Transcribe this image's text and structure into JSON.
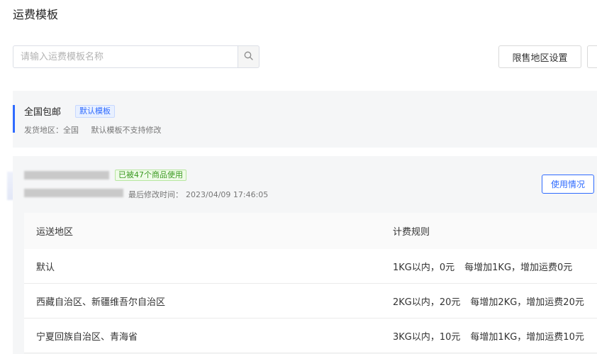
{
  "page": {
    "title": "运费模板"
  },
  "search": {
    "placeholder": "请输入运费模板名称",
    "icon": "search-icon"
  },
  "toolbar": {
    "restrict_label": "限售地区设置"
  },
  "default_template": {
    "name": "全国包邮",
    "tag": "默认模板",
    "ship_from": "发货地区：全国",
    "note": "默认模板不支持修改",
    "accent_color": "#2f6bff"
  },
  "template": {
    "used_tag": "已被47个商品使用",
    "modified_label": "最后修改时间：",
    "modified_time": "2023/04/09 17:46:05",
    "usage_button": "使用情况",
    "table": {
      "columns": [
        "运送地区",
        "计费规则"
      ],
      "rows": [
        {
          "region": "默认",
          "first": "1KG以内，0元",
          "extra": "每增加1KG，增加运费0元"
        },
        {
          "region": "西藏自治区、新疆维吾尔自治区",
          "first": "2KG以内，20元",
          "extra": "每增加2KG，增加运费20元"
        },
        {
          "region": "宁夏回族自治区、青海省",
          "first": "3KG以内，10元",
          "extra": "每增加1KG，增加运费10元"
        }
      ]
    }
  }
}
